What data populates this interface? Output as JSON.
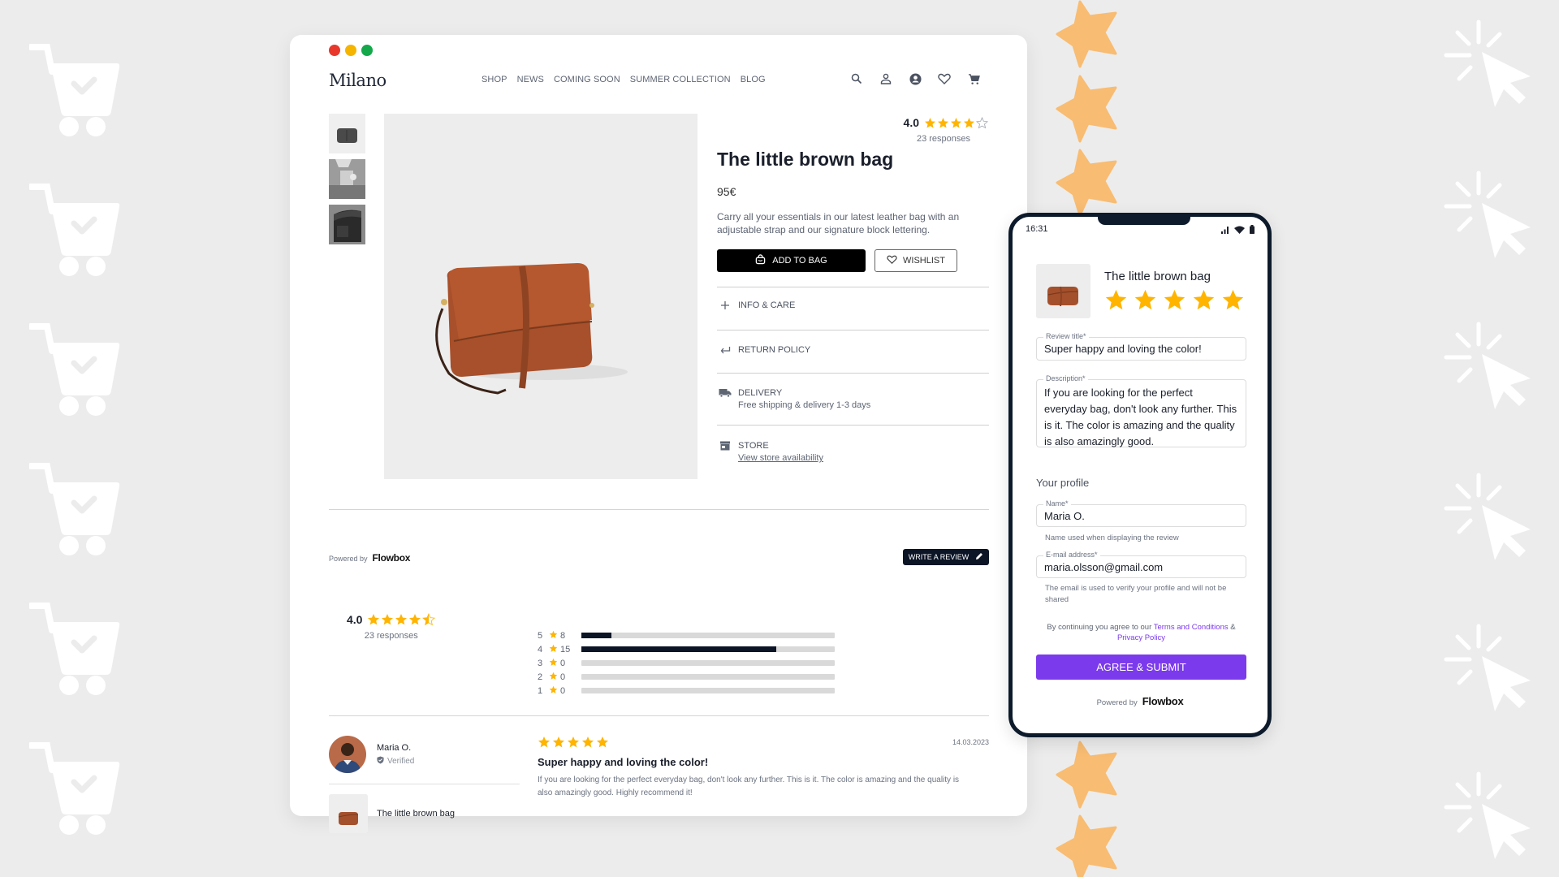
{
  "colors": {
    "background": "#ececec",
    "star": "#ffb400",
    "decor_star": "#f8bc72",
    "dark": "#0c1526",
    "accent_purple": "#7c3aed",
    "window_dot_red": "#e8382b",
    "window_dot_yellow": "#f5b400",
    "window_dot_green": "#14a84b"
  },
  "window": {
    "dots": [
      "close",
      "minimize",
      "maximize"
    ]
  },
  "header": {
    "logo": "Milano",
    "nav": [
      "SHOP",
      "NEWS",
      "COMING SOON",
      "SUMMER COLLECTION",
      "BLOG"
    ],
    "icons": [
      "search-icon",
      "user-icon",
      "account-circle-icon",
      "heart-icon",
      "cart-icon"
    ]
  },
  "gallery": {
    "thumbnails": [
      "bag-front-thumbnail",
      "bag-worn-thumbnail",
      "backpack-thumbnail"
    ],
    "main_image": "little-brown-bag-photo"
  },
  "product": {
    "rating": "4.0",
    "rating_stars": 4,
    "responses": "23 responses",
    "title": "The little brown bag",
    "price": "95€",
    "description": "Carry all your essentials in our latest leather bag with an adjustable strap and our signature block lettering.",
    "add_to_bag": "ADD TO BAG",
    "wishlist": "WISHLIST",
    "accordion": [
      {
        "icon": "plus-icon",
        "label": "INFO & CARE"
      },
      {
        "icon": "return-arrow-icon",
        "label": "RETURN POLICY"
      },
      {
        "icon": "truck-icon",
        "label": "DELIVERY",
        "sub": "Free shipping & delivery 1-3 days"
      },
      {
        "icon": "store-icon",
        "label": "STORE",
        "link": "View store availability"
      }
    ]
  },
  "reviews": {
    "powered_by": "Powered by",
    "brand": "Flowbox",
    "write_review": "WRITE A REVIEW",
    "average": "4.0",
    "average_stars": 4.5,
    "responses": "23 responses",
    "distribution": [
      {
        "stars": "5",
        "count": "8",
        "fill": 0.12
      },
      {
        "stars": "4",
        "count": "15",
        "fill": 0.77
      },
      {
        "stars": "3",
        "count": "0",
        "fill": 0
      },
      {
        "stars": "2",
        "count": "0",
        "fill": 0
      },
      {
        "stars": "1",
        "count": "0",
        "fill": 0
      }
    ],
    "items": [
      {
        "author": "Maria O.",
        "verified": "Verified",
        "product": "The little brown bag",
        "stars": 5,
        "date": "14.03.2023",
        "title": "Super happy and loving the color!",
        "body": "If you are looking for the perfect everyday bag, don't look any further. This is it. The color is amazing and the quality is also amazingly good. Highly recommend it!"
      }
    ]
  },
  "phone": {
    "time": "16:31",
    "product_name": "The little brown bag",
    "stars": 5,
    "review_title_label": "Review title*",
    "review_title_value": "Super happy and loving the color!",
    "description_label": "Description*",
    "description_value": "If you are looking for the perfect everyday bag, don't look any further. This is it. The color is amazing and the quality is also amazingly good.",
    "profile_heading": "Your profile",
    "name_label": "Name*",
    "name_value": "Maria O.",
    "name_hint": "Name used when displaying the review",
    "email_label": "E-mail address*",
    "email_value": "maria.olsson@gmail.com",
    "email_hint": "The email is used to verify your profile and will not be shared",
    "terms_prefix": "By continuing you agree to our ",
    "terms_link": "Terms and Conditions",
    "terms_amp": " & ",
    "privacy_link": "Privacy Policy",
    "submit": "AGREE & SUBMIT",
    "powered_by": "Powered by",
    "brand": "Flowbox"
  }
}
